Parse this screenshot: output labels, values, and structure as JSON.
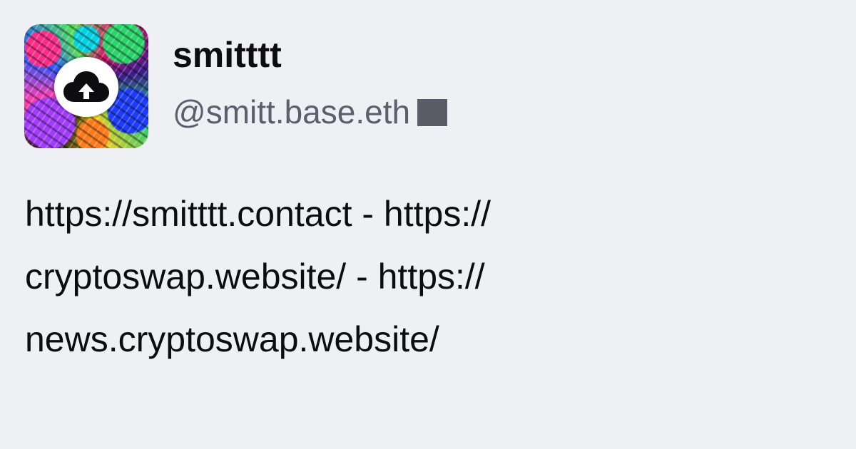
{
  "profile": {
    "display_name": "smitttt",
    "handle": "@smitt.base.eth",
    "avatar_icon": "cloud-upload-icon",
    "bio_lines": [
      "https://smitttt.contact - https://",
      "cryptoswap.website/ - https://",
      "news.cryptoswap.website/"
    ]
  },
  "colors": {
    "background": "#eff0f4",
    "name_text": "#0d0d0f",
    "handle_text": "#5a5f6e",
    "verified_square": "#5a5d68"
  }
}
